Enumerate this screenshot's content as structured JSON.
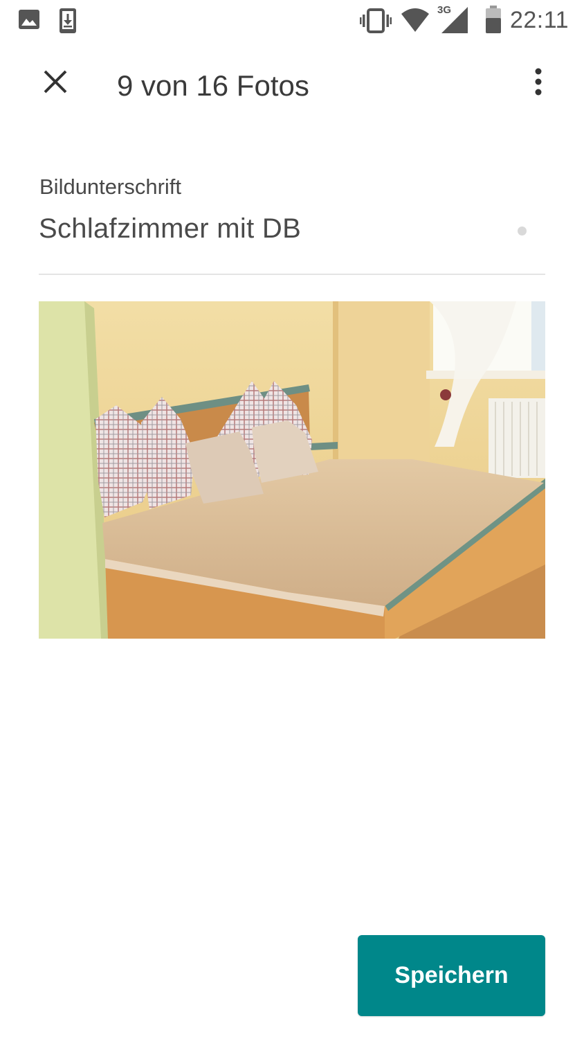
{
  "status_bar": {
    "time": "22:11",
    "network": "3G",
    "icons": [
      "image-icon",
      "download-icon",
      "vibrate-icon",
      "wifi-icon",
      "signal-icon",
      "battery-icon"
    ]
  },
  "header": {
    "title": "9 von 16 Fotos",
    "close_icon": "close-icon",
    "menu_icon": "more-vert-icon"
  },
  "caption": {
    "label": "Bildunterschrift",
    "value": "Schlafzimmer mit DB"
  },
  "actions": {
    "save_label": "Speichern"
  },
  "colors": {
    "accent": "#00878a",
    "text_primary": "#3a3a3a",
    "divider": "#e4e4e4",
    "background": "#ffffff"
  }
}
